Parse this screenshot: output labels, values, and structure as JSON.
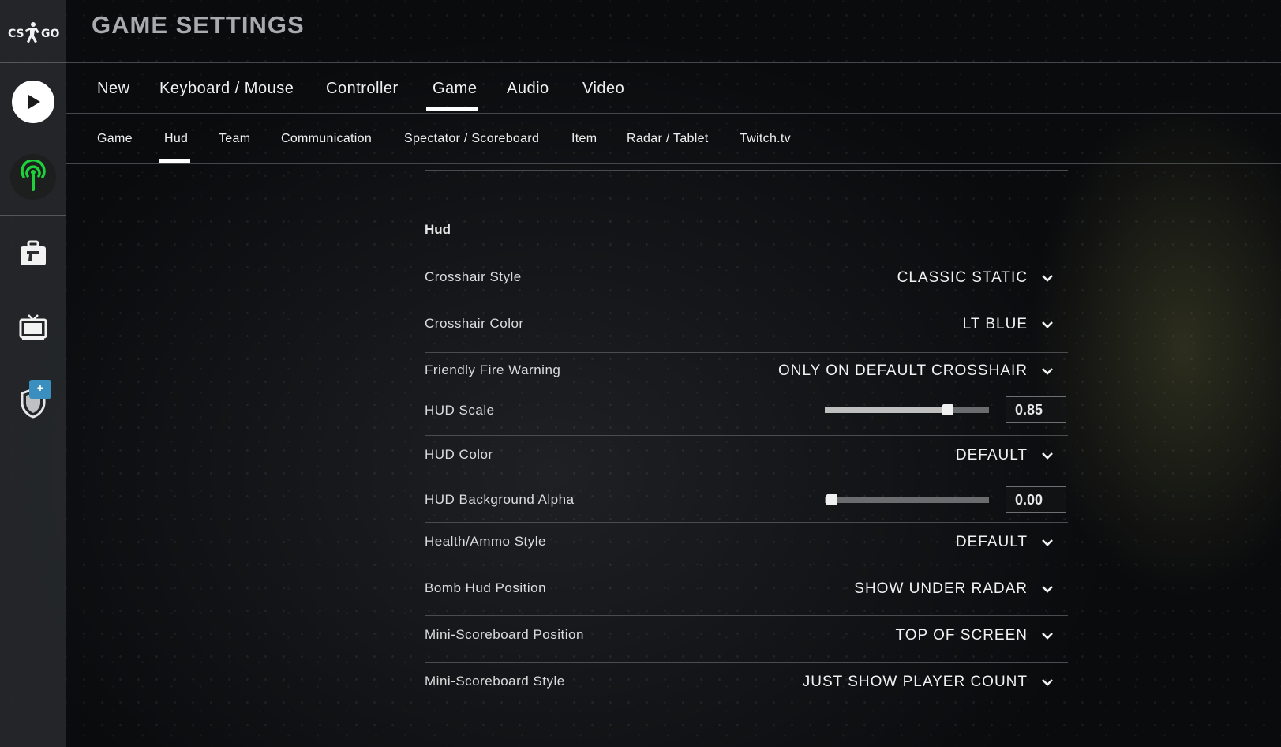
{
  "sidebar": {
    "logo_text": "CS GO",
    "icons": [
      "play-icon",
      "antenna-icon",
      "briefcase-gun-icon",
      "tv-icon",
      "shield-icon"
    ],
    "badge_text": "+"
  },
  "header": {
    "title": "GAME SETTINGS"
  },
  "main_tabs": [
    {
      "label": "New"
    },
    {
      "label": "Keyboard / Mouse"
    },
    {
      "label": "Controller"
    },
    {
      "label": "Game",
      "active": true
    },
    {
      "label": "Audio"
    },
    {
      "label": "Video"
    }
  ],
  "sub_tabs": [
    {
      "label": "Game"
    },
    {
      "label": "Hud",
      "active": true
    },
    {
      "label": "Team"
    },
    {
      "label": "Communication"
    },
    {
      "label": "Spectator / Scoreboard"
    },
    {
      "label": "Item"
    },
    {
      "label": "Radar / Tablet"
    },
    {
      "label": "Twitch.tv"
    }
  ],
  "panel": {
    "section_title": "Hud",
    "settings": [
      {
        "label": "Crosshair Style",
        "type": "dropdown",
        "value": "CLASSIC STATIC"
      },
      {
        "label": "Crosshair Color",
        "type": "dropdown",
        "value": "LT BLUE"
      },
      {
        "label": "Friendly Fire Warning",
        "type": "dropdown",
        "value": "ONLY ON DEFAULT CROSSHAIR"
      },
      {
        "label": "HUD Scale",
        "type": "slider",
        "value": "0.85",
        "level": 0.75
      },
      {
        "label": "HUD Color",
        "type": "dropdown",
        "value": "DEFAULT"
      },
      {
        "label": "HUD Background Alpha",
        "type": "slider",
        "value": "0.00",
        "level": 0.0
      },
      {
        "label": "Health/Ammo Style",
        "type": "dropdown",
        "value": "DEFAULT"
      },
      {
        "label": "Bomb Hud Position",
        "type": "dropdown",
        "value": "SHOW UNDER RADAR"
      },
      {
        "label": "Mini-Scoreboard Position",
        "type": "dropdown",
        "value": "TOP OF SCREEN"
      },
      {
        "label": "Mini-Scoreboard Style",
        "type": "dropdown",
        "value": "JUST SHOW PLAYER COUNT"
      }
    ]
  },
  "colors": {
    "accent": "#ffffff",
    "antenna_green": "#1fd13a",
    "badge_blue": "#3a8fbf"
  }
}
